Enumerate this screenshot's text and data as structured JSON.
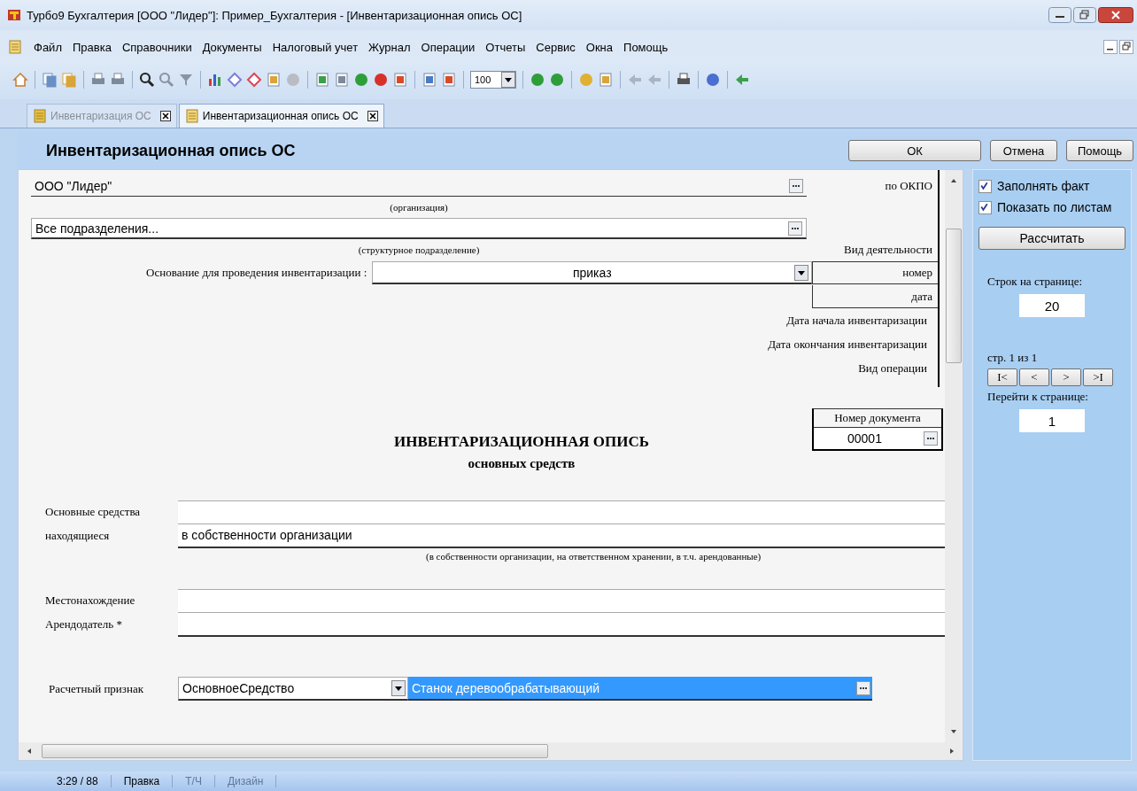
{
  "window": {
    "title": "Турбо9 Бухгалтерия [ООО \"Лидер\"]: Пример_Бухгалтерия - [Инвентаризационная опись ОС]"
  },
  "menu": [
    "Файл",
    "Правка",
    "Справочники",
    "Документы",
    "Налоговый учет",
    "Журнал",
    "Операции",
    "Отчеты",
    "Сервис",
    "Окна",
    "Помощь"
  ],
  "toolbar": {
    "zoom": "100"
  },
  "tabs": [
    {
      "label": "Инвентаризация ОС",
      "selected": false
    },
    {
      "label": "Инвентаризационная опись ОС",
      "selected": true
    }
  ],
  "form": {
    "title": "Инвентаризационная опись ОС",
    "buttons": [
      "ОК",
      "Отмена",
      "Помощь"
    ]
  },
  "document": {
    "organization": {
      "value": "ООО \"Лидер\"",
      "caption": "(организация)"
    },
    "okpo_label": "по ОКПО",
    "department": {
      "value": "Все подразделения...",
      "caption": "(структурное подразделение)"
    },
    "activity_label": "Вид деятельности",
    "basis": {
      "label": "Основание для проведения инвентаризации :",
      "value": "приказ"
    },
    "number_label": "номер",
    "date_label": "дата",
    "start_date_label": "Дата начала инвентаризации",
    "end_date_label": "Дата окончания инвентаризации",
    "operation_label": "Вид операции",
    "doc_number": {
      "header": "Номер документа",
      "value": "00001"
    },
    "heading": "ИНВЕНТАРИЗАЦИОННАЯ ОПИСЬ",
    "subheading": "основных средств",
    "assets": {
      "label_1": "Основные средства",
      "label_2": "находящиеся",
      "value": "в собственности организации",
      "caption": "(в собственности организации, на ответственном хранении, в т.ч. арендованные)"
    },
    "location_label": "Местонахождение",
    "lessor_label": "Арендодатель *",
    "calc": {
      "label": "Расчетный признак",
      "type": "ОсновноеСредство",
      "object": "Станок деревообрабатывающий"
    }
  },
  "side_panel": {
    "checkboxes": [
      {
        "label": "Заполнять факт",
        "checked": true
      },
      {
        "label": "Показать по листам",
        "checked": true
      }
    ],
    "calc_button": "Рассчитать",
    "rows_label": "Строк на странице:",
    "rows_value": "20",
    "page_info": "стр. 1 из 1",
    "pager": [
      "I<",
      "<",
      ">",
      ">I"
    ],
    "goto_label": "Перейти к странице:",
    "goto_value": "1"
  },
  "status_bar": [
    {
      "text": "3:29 / 88",
      "disabled": false
    },
    {
      "text": "Правка",
      "disabled": false
    },
    {
      "text": "Т/Ч",
      "disabled": true
    },
    {
      "text": "Дизайн",
      "disabled": true
    }
  ]
}
